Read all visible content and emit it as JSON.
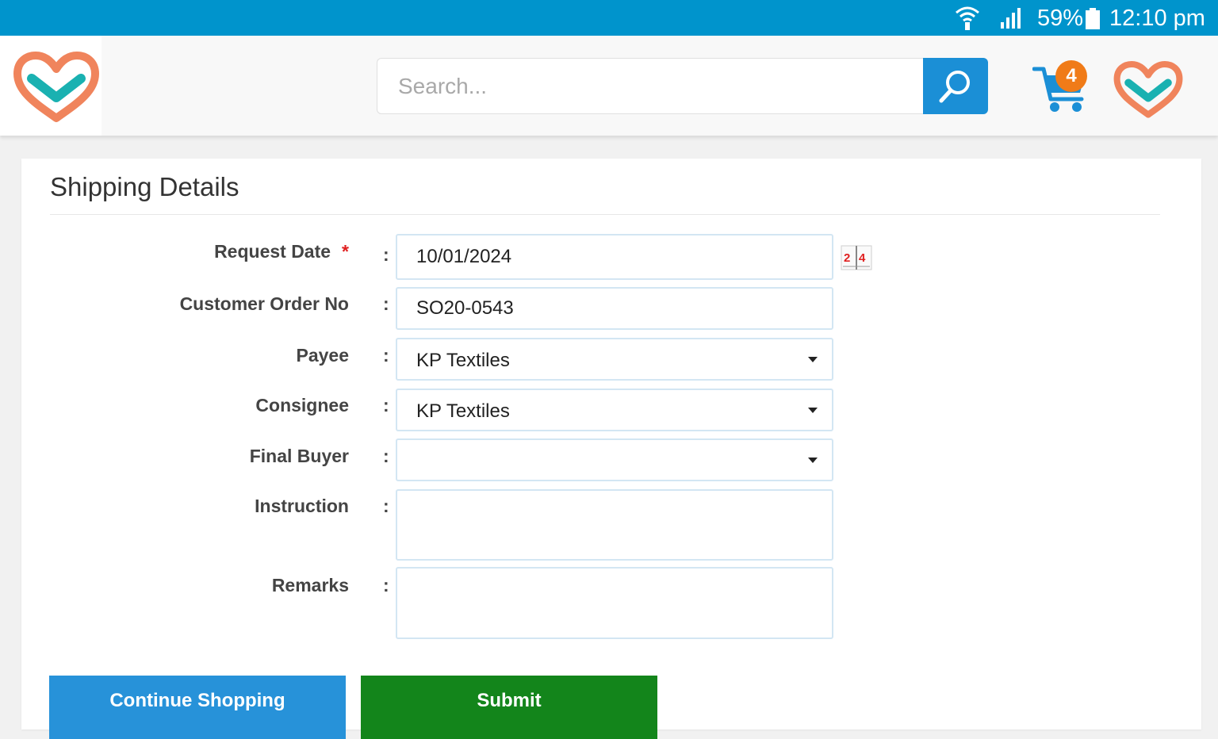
{
  "status_bar": {
    "battery_percent": "59%",
    "time": "12:10 pm",
    "icons": [
      "wifi-icon",
      "signal-icon",
      "battery-icon"
    ]
  },
  "header": {
    "search_placeholder": "Search...",
    "cart_count": "4",
    "icons": [
      "logo-icon",
      "search-icon",
      "cart-icon"
    ]
  },
  "form": {
    "title": "Shipping Details",
    "request_date": {
      "label": "Request Date",
      "required_mark": "*",
      "colon": ":",
      "value": "10/01/2024"
    },
    "customer_order_no": {
      "label": "Customer Order No",
      "colon": ":",
      "value": "SO20-0543"
    },
    "payee": {
      "label": "Payee",
      "colon": ":",
      "value": "KP Textiles"
    },
    "consignee": {
      "label": "Consignee",
      "colon": ":",
      "value": "KP Textiles"
    },
    "final_buyer": {
      "label": "Final Buyer",
      "colon": ":",
      "value": ""
    },
    "instruction": {
      "label": "Instruction",
      "colon": ":",
      "value": ""
    },
    "remarks": {
      "label": "Remarks",
      "colon": ":",
      "value": ""
    }
  },
  "buttons": {
    "continue_shopping": "Continue Shopping",
    "submit": "Submit"
  },
  "colors": {
    "status_bar": "#0094cc",
    "search_button": "#1b8fd6",
    "continue_button": "#2792d9",
    "submit_button": "#13851b",
    "logo_orange": "#f0845c",
    "logo_teal": "#1ab1b1",
    "badge": "#f07b18",
    "required": "#e02020"
  }
}
